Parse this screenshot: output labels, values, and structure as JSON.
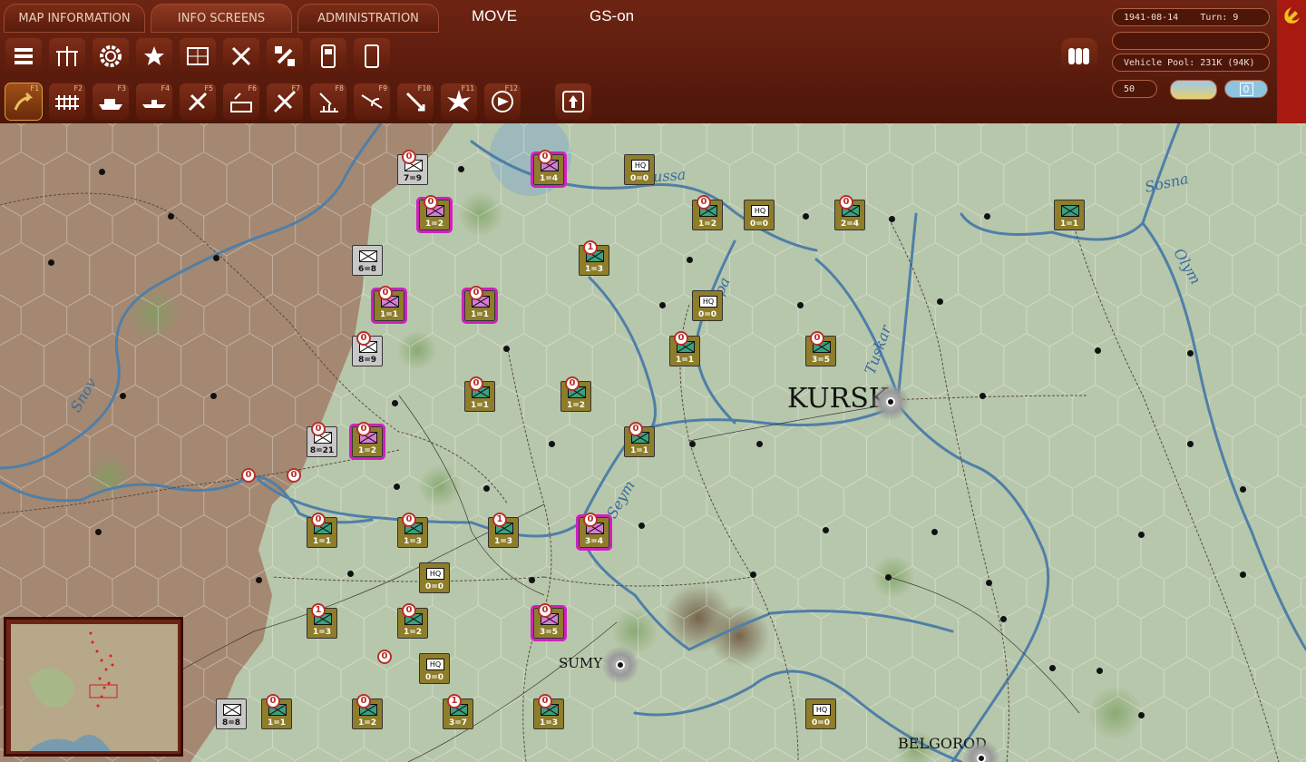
{
  "menu": {
    "tabs": [
      "MAP INFORMATION",
      "INFO SCREENS",
      "ADMINISTRATION"
    ],
    "mode": "MOVE",
    "gs_status": "GS-on"
  },
  "status": {
    "date": "1941-08-14",
    "turn_label": "Turn: 9",
    "blank": "",
    "vehicle_pool": "Vehicle Pool: 231K (94K)",
    "value_50": "50",
    "toggle_value": "0"
  },
  "toolbar_row1": [
    "unit-list-icon",
    "tree-icon",
    "gear-icon",
    "star-icon",
    "sector-icon",
    "air-icon",
    "satellite-icon",
    "card-icon",
    "card2-icon"
  ],
  "toolbar_row2": [
    {
      "icon": "move-icon",
      "fkey": "F1"
    },
    {
      "icon": "rail-icon",
      "fkey": "F2"
    },
    {
      "icon": "naval-icon",
      "fkey": "F3"
    },
    {
      "icon": "ship-icon",
      "fkey": "F4"
    },
    {
      "icon": "air-transfer-icon",
      "fkey": "F5"
    },
    {
      "icon": "airfield-icon",
      "fkey": "F6"
    },
    {
      "icon": "air-strike-icon",
      "fkey": "F7"
    },
    {
      "icon": "bombing-icon",
      "fkey": "F8"
    },
    {
      "icon": "paradrop-icon",
      "fkey": "F9"
    },
    {
      "icon": "interdiction-icon",
      "fkey": "F10"
    },
    {
      "icon": "explosion-icon",
      "fkey": "F11"
    },
    {
      "icon": "compass-icon",
      "fkey": "F12"
    }
  ],
  "map": {
    "cities": [
      {
        "name": "KURSK",
        "size": "large"
      },
      {
        "name": "SUMY",
        "size": "small"
      },
      {
        "name": "BELGOROD",
        "size": "small"
      }
    ],
    "rivers": [
      "Sosna",
      "Olym",
      "Tuskar",
      "Snov",
      "Seym",
      "ussa",
      "pa"
    ],
    "units": [
      {
        "label": "7=9",
        "marker": "0",
        "side": "axis"
      },
      {
        "label": "1=4",
        "marker": "0",
        "side": "soviet",
        "sel": true
      },
      {
        "label": "0=0",
        "type": "HQ",
        "side": "soviet"
      },
      {
        "label": "1=2",
        "marker": "0",
        "side": "soviet",
        "sel": true
      },
      {
        "label": "1=2",
        "marker": "0",
        "side": "soviet"
      },
      {
        "label": "0=0",
        "type": "HQ",
        "side": "soviet"
      },
      {
        "label": "2=4",
        "marker": "0",
        "side": "soviet"
      },
      {
        "label": "1=1",
        "side": "soviet"
      },
      {
        "label": "6=8",
        "side": "axis"
      },
      {
        "label": "1=3",
        "marker": "1",
        "side": "soviet"
      },
      {
        "label": "1=1",
        "marker": "0",
        "side": "soviet",
        "sel": true
      },
      {
        "label": "1=1",
        "marker": "0",
        "side": "soviet",
        "sel": true
      },
      {
        "label": "0=0",
        "type": "HQ",
        "side": "soviet"
      },
      {
        "label": "8=9",
        "marker": "0",
        "side": "axis"
      },
      {
        "label": "1=1",
        "marker": "0",
        "side": "soviet"
      },
      {
        "label": "3=5",
        "marker": "0",
        "side": "soviet"
      },
      {
        "label": "1=1",
        "marker": "0",
        "side": "soviet"
      },
      {
        "label": "1=2",
        "marker": "0",
        "side": "soviet"
      },
      {
        "label": "8=21",
        "marker": "0",
        "side": "axis"
      },
      {
        "label": "1=2",
        "marker": "0",
        "side": "soviet",
        "sel": true
      },
      {
        "label": "1=1",
        "marker": "0",
        "side": "soviet"
      },
      {
        "label": "1=1",
        "marker": "0",
        "side": "soviet"
      },
      {
        "label": "1=3",
        "marker": "0",
        "side": "soviet"
      },
      {
        "label": "1=3",
        "marker": "1",
        "side": "soviet"
      },
      {
        "label": "3=4",
        "marker": "0",
        "side": "soviet",
        "sel": true
      },
      {
        "label": "0=0",
        "type": "HQ",
        "side": "soviet"
      },
      {
        "label": "1=3",
        "marker": "1",
        "side": "soviet"
      },
      {
        "label": "1=2",
        "marker": "0",
        "side": "soviet"
      },
      {
        "label": "3=5",
        "marker": "0",
        "side": "soviet",
        "sel": true
      },
      {
        "label": "0=0",
        "type": "HQ",
        "side": "soviet"
      },
      {
        "label": "8=8",
        "side": "axis"
      },
      {
        "label": "1=1",
        "marker": "0",
        "side": "soviet"
      },
      {
        "label": "1=2",
        "marker": "0",
        "side": "soviet"
      },
      {
        "label": "3=7",
        "marker": "1",
        "side": "soviet"
      },
      {
        "label": "1=3",
        "marker": "0",
        "side": "soviet"
      },
      {
        "label": "0=0",
        "type": "HQ",
        "side": "soviet"
      }
    ]
  }
}
